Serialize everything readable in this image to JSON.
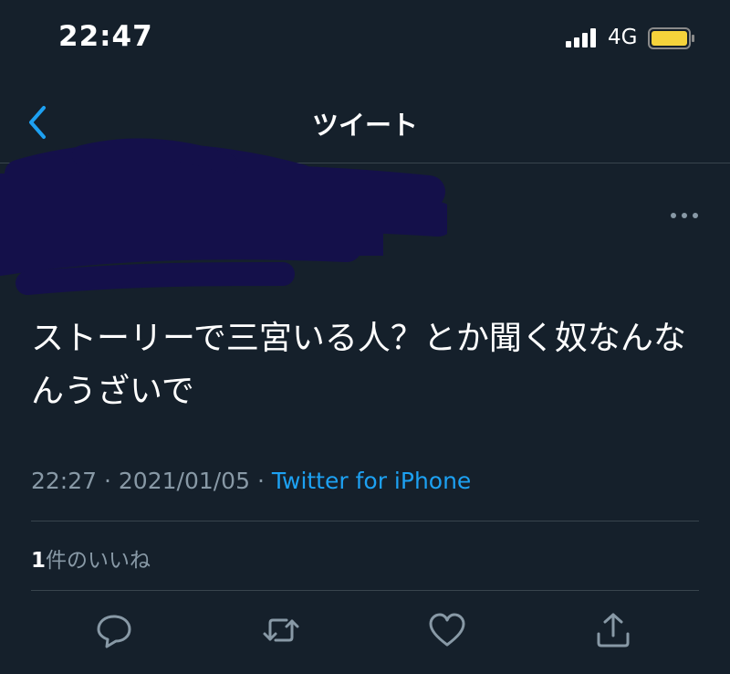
{
  "status_bar": {
    "time": "22:47",
    "network": "4G"
  },
  "nav": {
    "title": "ツイート"
  },
  "tweet": {
    "text": "ストーリーで三宮いる人？とか聞く奴なんなんうざいで",
    "time": "22:27",
    "date": "2021/01/05",
    "source": "Twitter for iPhone",
    "separator": "·",
    "likes_count": "1",
    "likes_label": "件のいいね"
  },
  "colors": {
    "background": "#15202b",
    "accent": "#1da1f2",
    "muted": "#8899a6",
    "divider": "#38444d",
    "battery": "#f5d33b",
    "redaction": "#14104a"
  },
  "icons": [
    "chevron-left-icon",
    "more-icon",
    "reply-icon",
    "retweet-icon",
    "like-icon",
    "share-icon",
    "signal-icon",
    "battery-icon"
  ]
}
